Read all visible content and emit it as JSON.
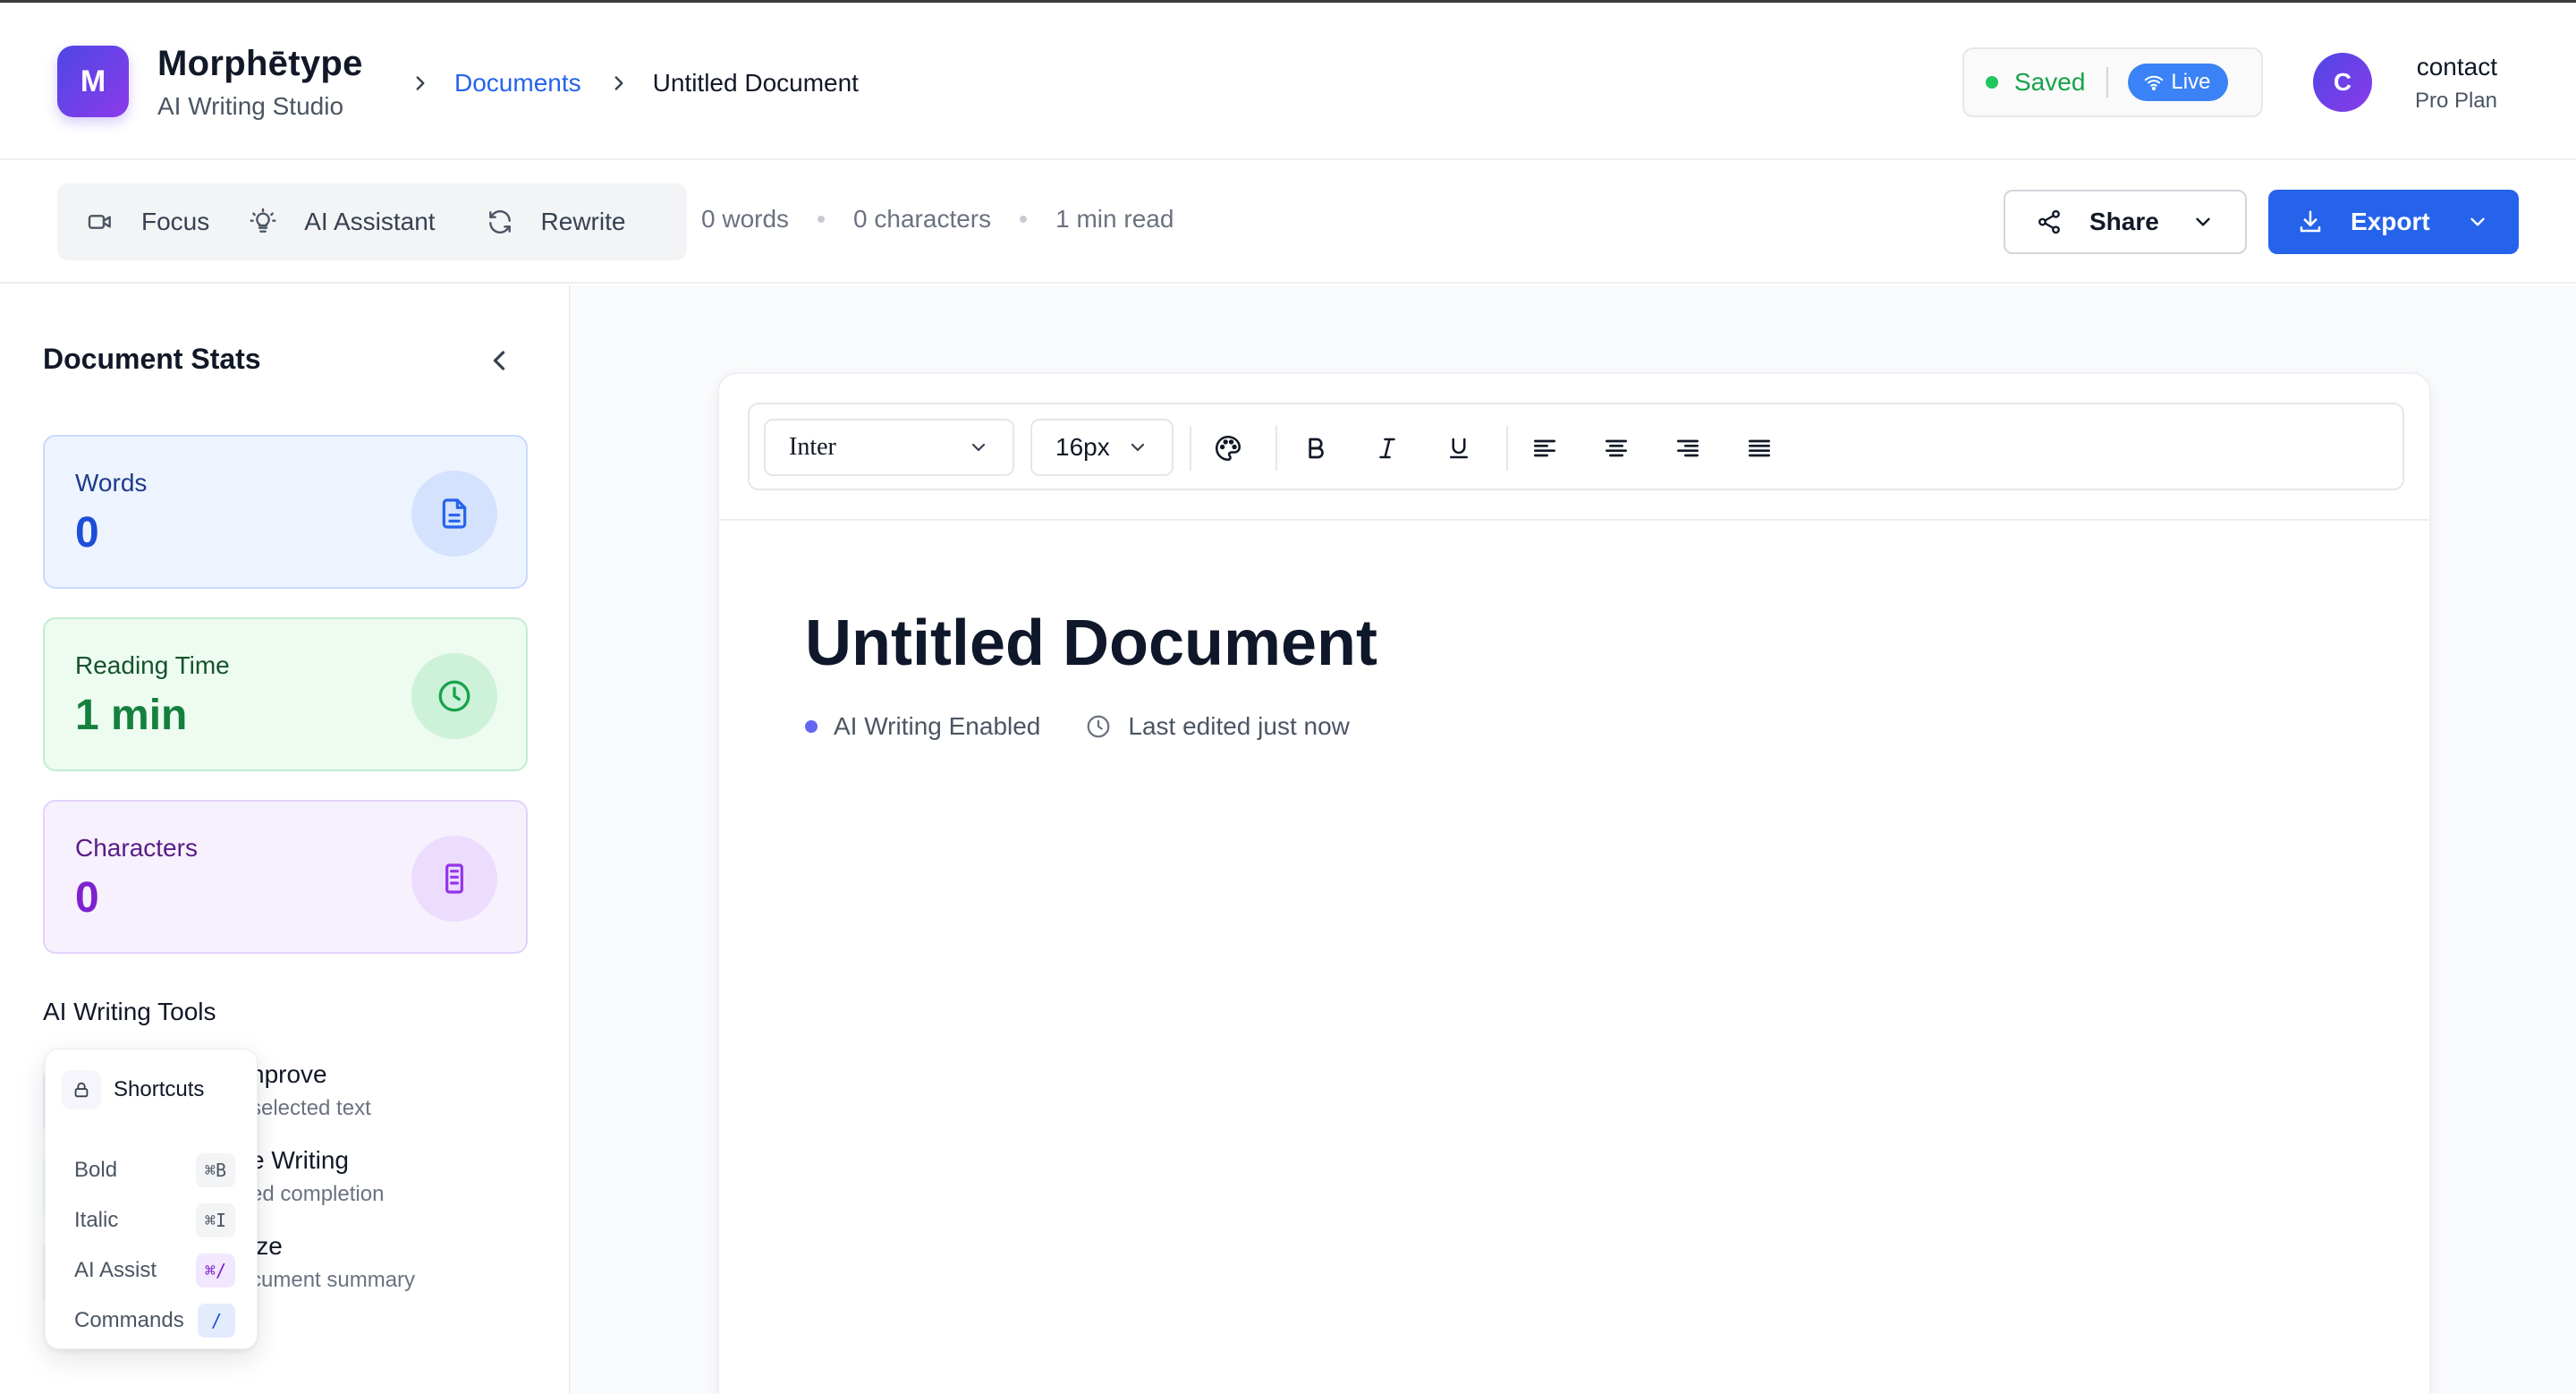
{
  "brand": {
    "logo_letter": "M",
    "name": "Morphētype",
    "subtitle": "AI Writing Studio"
  },
  "breadcrumb": {
    "link": "Documents",
    "current": "Untitled Document"
  },
  "status": {
    "saved": "Saved",
    "live": "Live",
    "saved_color": "#22c55e",
    "live_color": "#3b82f6"
  },
  "user": {
    "initial": "C",
    "name": "contact",
    "plan": "Pro Plan"
  },
  "toolbar": {
    "modes": [
      {
        "label": "Focus",
        "icon": "video-icon"
      },
      {
        "label": "AI Assistant",
        "icon": "lightbulb-icon"
      },
      {
        "label": "Rewrite",
        "icon": "refresh-icon"
      }
    ],
    "stats": {
      "words": "0 words",
      "characters": "0 characters",
      "read": "1 min read"
    },
    "share_label": "Share",
    "export_label": "Export",
    "accent": "#2563eb"
  },
  "sidebar": {
    "title": "Document Stats",
    "cards": [
      {
        "label": "Words",
        "value": "0",
        "icon": "document-icon"
      },
      {
        "label": "Reading Time",
        "value": "1 min",
        "icon": "clock-icon"
      },
      {
        "label": "Characters",
        "value": "0",
        "icon": "text-icon"
      }
    ],
    "tools_title": "AI Writing Tools",
    "tools": [
      {
        "name": "Improve",
        "name_visible": "nprove",
        "desc_visible": "selected text"
      },
      {
        "name": "Writing",
        "name_visible": "e Writing",
        "desc_visible": "ed completion"
      },
      {
        "name": "Summarize",
        "name_visible": "ize",
        "desc_visible": "cument summary"
      }
    ]
  },
  "shortcuts": {
    "title": "Shortcuts",
    "items": [
      {
        "label": "Bold",
        "key": "⌘B"
      },
      {
        "label": "Italic",
        "key": "⌘I"
      },
      {
        "label": "AI Assist",
        "key": "⌘/"
      },
      {
        "label": "Commands",
        "key": "/"
      }
    ]
  },
  "editor": {
    "font": "Inter",
    "size": "16px",
    "title": "Untitled Document",
    "ai_status": "AI Writing Enabled",
    "last_edited": "Last edited just now"
  }
}
